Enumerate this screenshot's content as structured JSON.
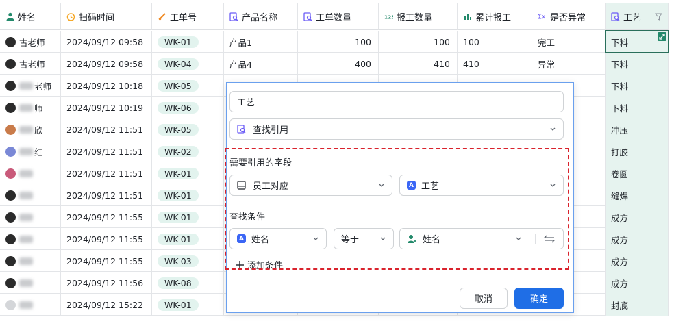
{
  "columns": [
    {
      "label": "姓名",
      "icon": "person-icon"
    },
    {
      "label": "扫码时间",
      "icon": "alarm-clock-icon"
    },
    {
      "label": "工单号",
      "icon": "link-icon"
    },
    {
      "label": "产品名称",
      "icon": "lookup-icon"
    },
    {
      "label": "工单数量",
      "icon": "lookup-icon"
    },
    {
      "label": "报工数量",
      "icon": "number-123-icon"
    },
    {
      "label": "累计报工",
      "icon": "bar-chart-icon"
    },
    {
      "label": "是否异常",
      "icon": "formula-icon"
    },
    {
      "label": "工艺",
      "icon": "lookup-icon"
    }
  ],
  "rows": [
    {
      "name_suffix": "古老师",
      "time": "2024/09/12 09:58",
      "order": "WK-01",
      "product": "产品1",
      "qty": "100",
      "report": "100",
      "total": "100",
      "abnormal": "完工",
      "process": "下料"
    },
    {
      "name_suffix": "古老师",
      "time": "2024/09/12 09:58",
      "order": "WK-04",
      "product": "产品4",
      "qty": "400",
      "report": "410",
      "total": "410",
      "abnormal": "异常",
      "process": "下料"
    },
    {
      "name_suffix": "老师",
      "time": "2024/09/12 10:18",
      "order": "WK-05",
      "product": "",
      "qty": "",
      "report": "",
      "total": "",
      "abnormal": "",
      "process": "下料"
    },
    {
      "name_suffix": "师",
      "time": "2024/09/12 10:19",
      "order": "WK-06",
      "product": "",
      "qty": "",
      "report": "",
      "total": "",
      "abnormal": "",
      "process": "下料"
    },
    {
      "name_suffix": "欣",
      "time": "2024/09/12 11:51",
      "order": "WK-05",
      "product": "",
      "qty": "",
      "report": "",
      "total": "",
      "abnormal": "",
      "process": "冲压"
    },
    {
      "name_suffix": "红",
      "time": "2024/09/12 11:51",
      "order": "WK-02",
      "product": "",
      "qty": "",
      "report": "",
      "total": "",
      "abnormal": "",
      "process": "打胶"
    },
    {
      "name_suffix": "",
      "time": "2024/09/12 11:51",
      "order": "WK-01",
      "product": "",
      "qty": "",
      "report": "",
      "total": "",
      "abnormal": "",
      "process": "卷圆"
    },
    {
      "name_suffix": "",
      "time": "2024/09/12 11:51",
      "order": "WK-01",
      "product": "",
      "qty": "",
      "report": "",
      "total": "",
      "abnormal": "",
      "process": "缝焊"
    },
    {
      "name_suffix": "",
      "time": "2024/09/12 11:55",
      "order": "WK-01",
      "product": "",
      "qty": "",
      "report": "",
      "total": "",
      "abnormal": "",
      "process": "成方"
    },
    {
      "name_suffix": "",
      "time": "2024/09/12 11:55",
      "order": "WK-01",
      "product": "",
      "qty": "",
      "report": "",
      "total": "",
      "abnormal": "",
      "process": "成方"
    },
    {
      "name_suffix": "",
      "time": "2024/09/12 11:55",
      "order": "WK-03",
      "product": "",
      "qty": "",
      "report": "",
      "total": "",
      "abnormal": "",
      "process": "成方"
    },
    {
      "name_suffix": "",
      "time": "2024/09/12 11:56",
      "order": "WK-08",
      "product": "",
      "qty": "",
      "report": "",
      "total": "",
      "abnormal": "",
      "process": "成方"
    },
    {
      "name_suffix": "",
      "time": "2024/09/12 15:22",
      "order": "WK-01",
      "product": "",
      "qty": "",
      "report": "",
      "total": "",
      "abnormal": "",
      "process": "封底"
    }
  ],
  "dialog": {
    "field_name": "工艺",
    "field_type": "查找引用",
    "section_ref": "需要引用的字段",
    "ref_table": "员工对应",
    "ref_field": "工艺",
    "section_cond": "查找条件",
    "cond_field": "姓名",
    "cond_op": "等于",
    "cond_value": "姓名",
    "add_condition": "添加条件",
    "cancel": "取消",
    "confirm": "确定"
  },
  "colors": {
    "accent": "#1f6ee6",
    "process_col_bg": "#e6f3ef",
    "tag_bg": "#e2f3ee",
    "dash_red": "#d9232d"
  }
}
